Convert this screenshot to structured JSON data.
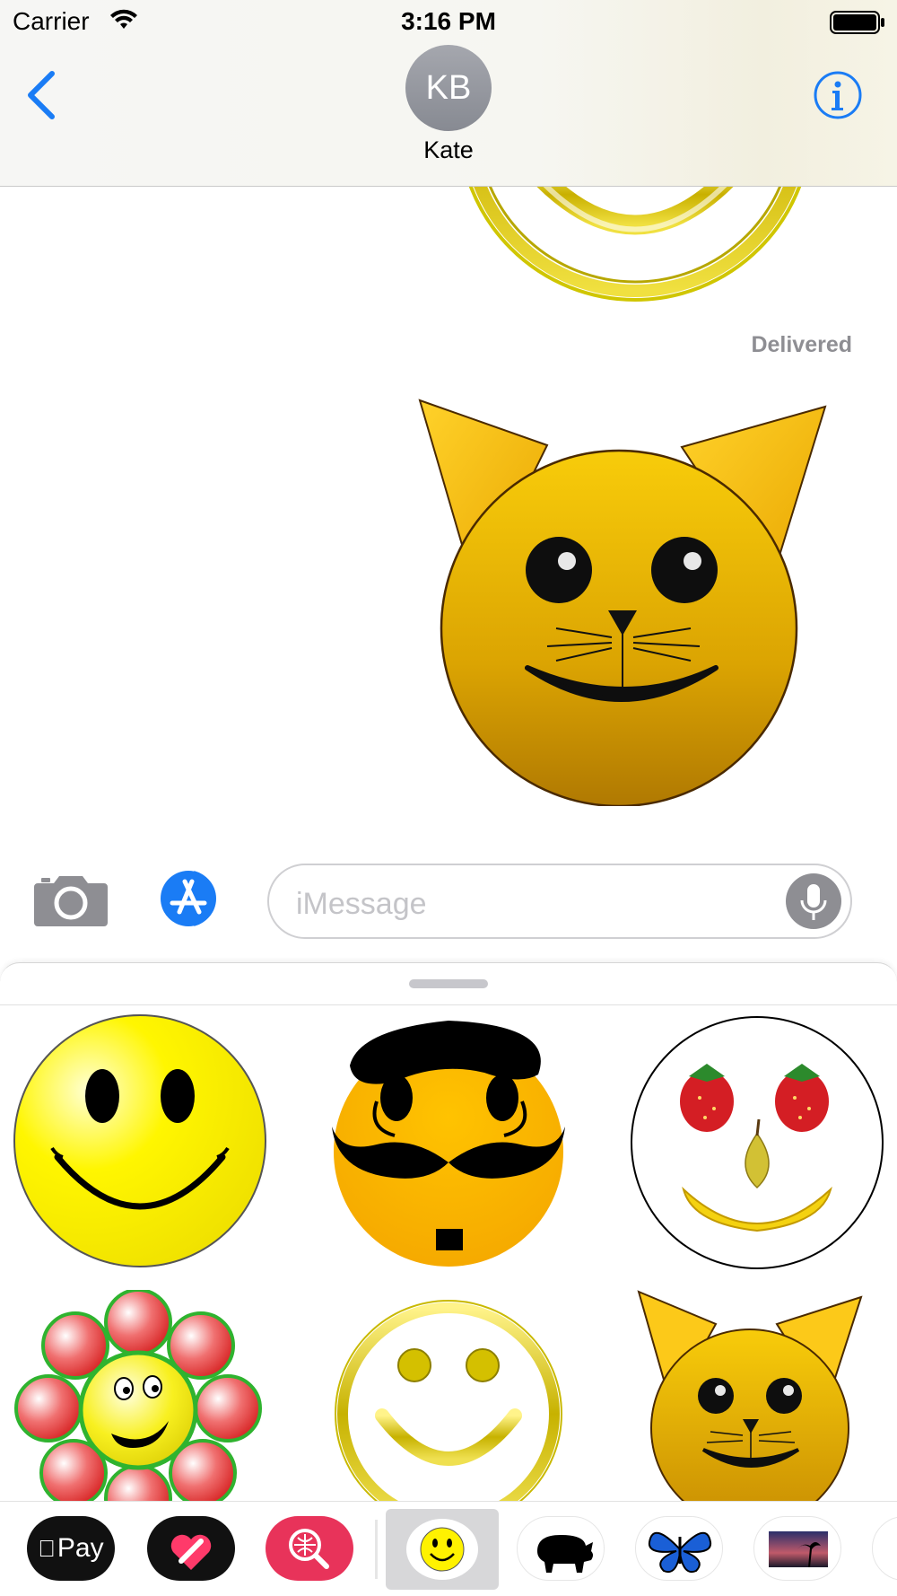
{
  "status_bar": {
    "carrier": "Carrier",
    "time": "3:16 PM"
  },
  "nav": {
    "avatar_initials": "KB",
    "contact_name": "Kate"
  },
  "conversation": {
    "delivered_label": "Delivered"
  },
  "compose": {
    "placeholder": "iMessage"
  },
  "sticker_grid": [
    {
      "name": "smiley-face-sticker"
    },
    {
      "name": "mustache-face-sticker"
    },
    {
      "name": "fruit-face-sticker"
    },
    {
      "name": "flower-face-sticker"
    },
    {
      "name": "gold-ring-smiley-sticker"
    },
    {
      "name": "cat-face-sticker"
    }
  ],
  "app_strip": {
    "apple_pay_label": "Pay",
    "apps": [
      "apple-pay-icon",
      "digital-touch-icon",
      "web-images-search-icon",
      "smiley-stickers-app-icon",
      "pig-app-icon",
      "butterfly-app-icon",
      "sunset-photo-app-icon"
    ]
  },
  "colors": {
    "ios_blue": "#1a7cf5",
    "sticker_yellow": "#f5c400",
    "nav_background": "#f6f6f2"
  }
}
